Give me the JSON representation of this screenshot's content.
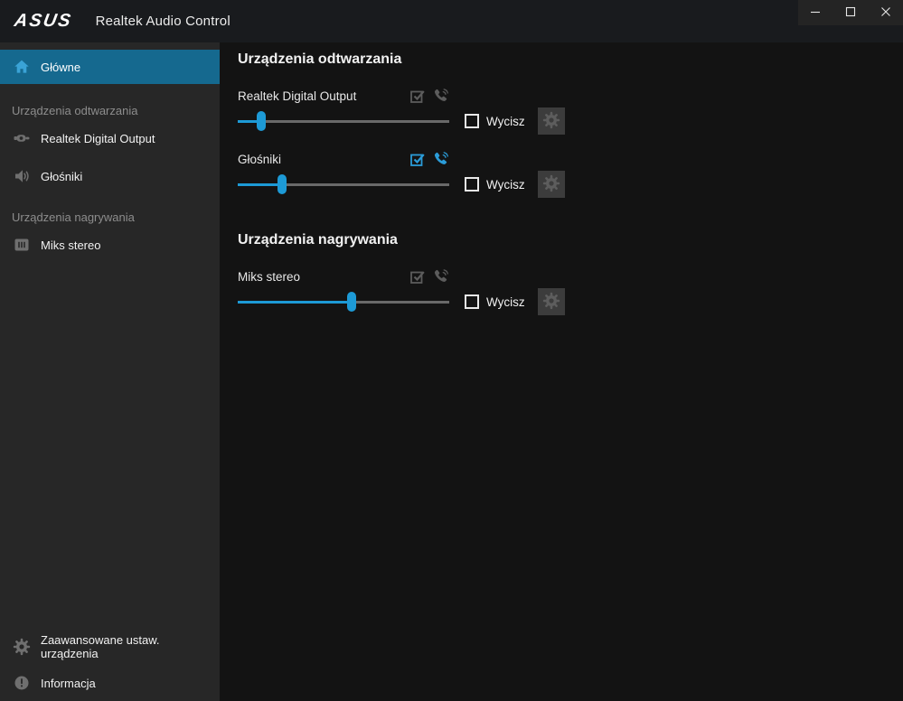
{
  "titlebar": {
    "logo": "ASUS",
    "title": "Realtek Audio Control",
    "controls": [
      {
        "name": "minimize-button",
        "icon": "minimize-icon"
      },
      {
        "name": "maximize-button",
        "icon": "maximize-icon"
      },
      {
        "name": "close-button",
        "icon": "close-icon"
      }
    ]
  },
  "sidebar": {
    "main_item": {
      "label": "Główne",
      "icon": "home-icon",
      "active": true
    },
    "sections": [
      {
        "label": "Urządzenia odtwarzania",
        "items": [
          {
            "label": "Realtek Digital Output",
            "icon": "digital-output-icon"
          },
          {
            "label": "Głośniki",
            "icon": "speaker-icon"
          }
        ]
      },
      {
        "label": "Urządzenia nagrywania",
        "items": [
          {
            "label": "Miks stereo",
            "icon": "stereo-mix-icon"
          }
        ]
      }
    ],
    "footer_items": [
      {
        "label": "Zaawansowane ustaw. urządzenia",
        "icon": "gear-icon"
      },
      {
        "label": "Informacja",
        "icon": "info-icon"
      }
    ]
  },
  "main": {
    "sections": [
      {
        "heading": "Urządzenia odtwarzania",
        "devices": [
          {
            "name": "Realtek Digital Output",
            "volume_percent": 11,
            "default_device": false,
            "default_communication": false,
            "mute_label": "Wycisz",
            "muted": false
          },
          {
            "name": "Głośniki",
            "volume_percent": 21,
            "default_device": true,
            "default_communication": true,
            "mute_label": "Wycisz",
            "muted": false
          }
        ]
      },
      {
        "heading": "Urządzenia nagrywania",
        "devices": [
          {
            "name": "Miks stereo",
            "volume_percent": 54,
            "default_device": false,
            "default_communication": false,
            "mute_label": "Wycisz",
            "muted": false
          }
        ]
      }
    ]
  },
  "colors": {
    "accent_blue": "#1d9ad6",
    "active_item_bg": "#15698f",
    "sidebar_bg": "#272727",
    "main_bg": "#131313",
    "titlebar_bg": "#191b1e",
    "icon_gray": "#6f6f6f"
  }
}
